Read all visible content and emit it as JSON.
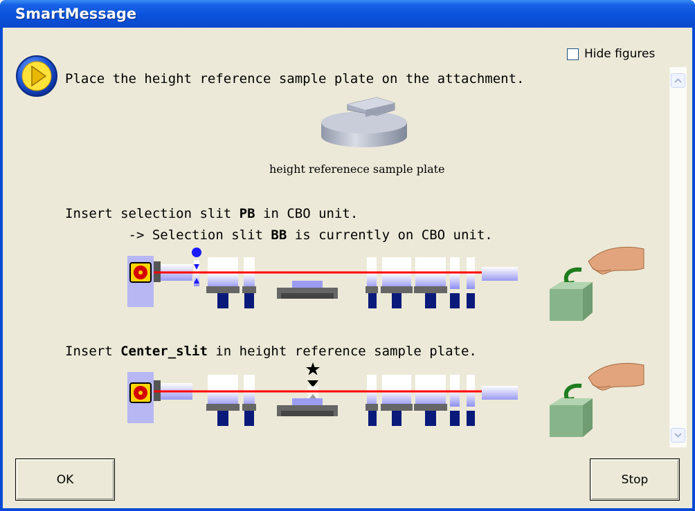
{
  "window": {
    "title": "SmartMessage"
  },
  "hide_figures": {
    "label": "Hide figures",
    "checked": false
  },
  "message": {
    "line1": "Place the height reference sample plate on the attachment.",
    "caption": "height referenece sample plate",
    "step1_a": "Insert selection slit ",
    "step1_b": "PB",
    "step1_c": " in CBO unit.",
    "step1_d": "        -> Selection slit ",
    "step1_e": "BB",
    "step1_f": " is currently on CBO unit.",
    "step2_a": "Insert ",
    "step2_b": "Center_slit",
    "step2_c": " in height reference sample plate."
  },
  "buttons": {
    "ok": "OK",
    "stop": "Stop"
  },
  "colors": {
    "title_bar": "#0b52db",
    "beam": "#ff0000",
    "dialog_bg": "#ece9d8"
  }
}
